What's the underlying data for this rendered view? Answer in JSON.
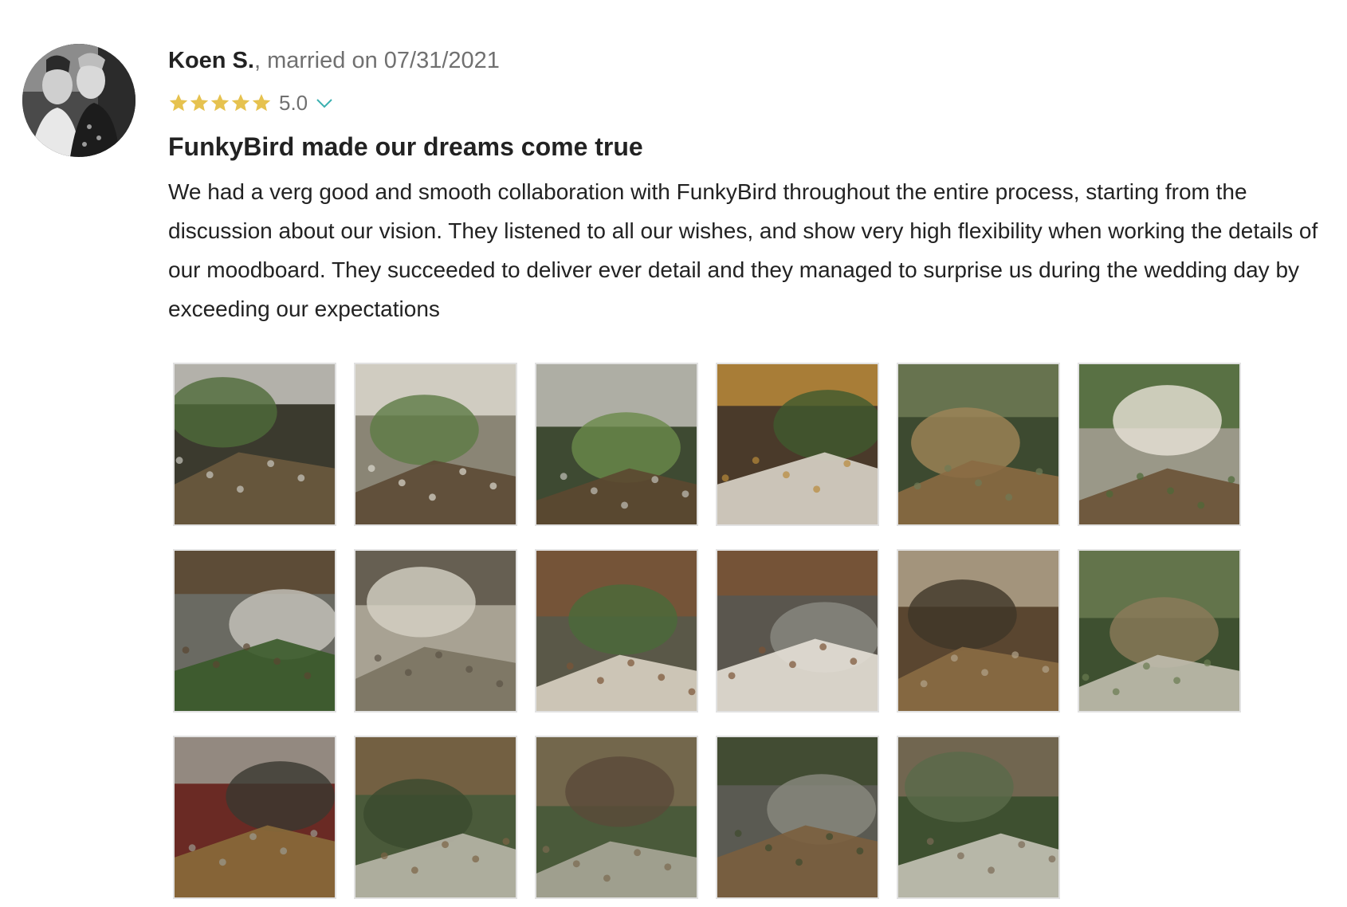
{
  "review": {
    "author": "Koen S.",
    "married_text": ", married on 07/31/2021",
    "rating": "5.0",
    "stars": 5,
    "star_color": "#e6c24f",
    "chevron_color": "#3ab0b0",
    "title": "FunkyBird made our dreams come true",
    "body": "We had a verg good and smooth collaboration with FunkyBird throughout the entire process, starting from the discussion about our vision. They listened to all our wishes, and show very high flexibility when working the details of our moodboard. They succeeded to deliver ever detail and they managed to surprise us during the wedding day by exceeding our expectations"
  },
  "icons": {
    "star": "star-icon",
    "expand": "chevron-down-icon"
  },
  "photos": [
    {
      "scene": "long-table-greenery"
    },
    {
      "scene": "table-candles-courtyard"
    },
    {
      "scene": "table-under-tree"
    },
    {
      "scene": "glasses-flowers-closeup"
    },
    {
      "scene": "chairs-rows-lawn"
    },
    {
      "scene": "long-table-string-lights"
    },
    {
      "scene": "tables-big-tree"
    },
    {
      "scene": "villa-courtyard-tables"
    },
    {
      "scene": "couple-walking-aisle"
    },
    {
      "scene": "couple-doorway"
    },
    {
      "scene": "chairs-dried-flowers"
    },
    {
      "scene": "floral-arch"
    },
    {
      "scene": "books-baskets"
    },
    {
      "scene": "ceremony-aisle-tree"
    },
    {
      "scene": "ceremony-guests-tree"
    },
    {
      "scene": "place-cards-table"
    },
    {
      "scene": "tree-canopy-reception"
    }
  ]
}
